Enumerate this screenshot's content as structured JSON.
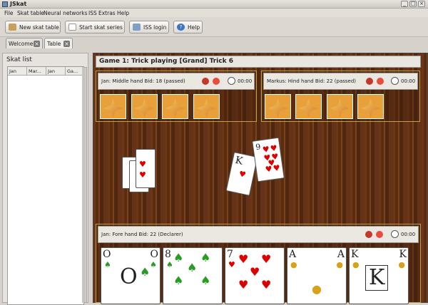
{
  "window": {
    "title": "JSkat"
  },
  "menu": [
    "File",
    "Skat table",
    "Neural networks",
    "ISS",
    "Extras",
    "Help"
  ],
  "toolbar": {
    "new_table": "New skat table",
    "start_series": "Start skat series",
    "iss_login": "ISS login",
    "help": "Help"
  },
  "tabs": [
    {
      "label": "Welcome"
    },
    {
      "label": "Table"
    }
  ],
  "skat_list": {
    "title": "Skat list",
    "columns": [
      "Jan",
      "Mar...",
      "Jan",
      "Ga..."
    ]
  },
  "game": {
    "header": "Game 1: Trick playing [Grand] Trick 6",
    "opponents": [
      {
        "info": "Jan: Middle hand Bid: 18 (passed)",
        "time": "00:00",
        "hidden_cards": 4
      },
      {
        "info": "Markus: Hind hand Bid: 22 (passed)",
        "time": "00:00",
        "hidden_cards": 4
      }
    ],
    "player": {
      "info": "Jan: Fore hand Bid: 22 (Declarer)",
      "time": "00:00"
    },
    "hand": [
      {
        "rank": "O",
        "suit": "leaf"
      },
      {
        "rank": "8",
        "suit": "leaf"
      },
      {
        "rank": "7",
        "suit": "heart"
      },
      {
        "rank": "A",
        "suit": "bell"
      },
      {
        "rank": "K",
        "suit": "bell"
      }
    ],
    "trick": [
      {
        "rank": "K",
        "suit": "heart"
      },
      {
        "rank": "9",
        "suit": "heart"
      }
    ]
  },
  "colors": {
    "heart": "#d00000",
    "leaf": "#2c9a27",
    "bell": "#d7a219",
    "panel_border": "#bda14b"
  }
}
